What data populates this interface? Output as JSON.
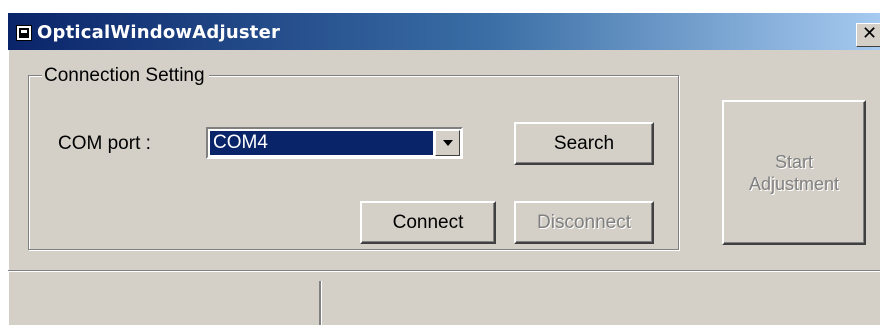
{
  "window": {
    "title": "OpticalWindowAdjuster",
    "close_glyph": "✕",
    "app_icon": "application-icon"
  },
  "connection_group": {
    "label": "Connection Setting",
    "com_port_label": "COM port :",
    "com_port_value": "COM4",
    "search_label": "Search",
    "connect_label": "Connect",
    "disconnect_label": "Disconnect",
    "disconnect_enabled": false
  },
  "start_button": {
    "line1": "Start",
    "line2": "Adjustment",
    "enabled": false
  },
  "status_bar": {
    "panels": [
      "",
      ""
    ]
  },
  "colors": {
    "title_gradient_start": "#0a246a",
    "title_gradient_end": "#a6caf0",
    "face": "#d4d0c8",
    "selection": "#0a246a",
    "disabled_text": "#808080"
  }
}
